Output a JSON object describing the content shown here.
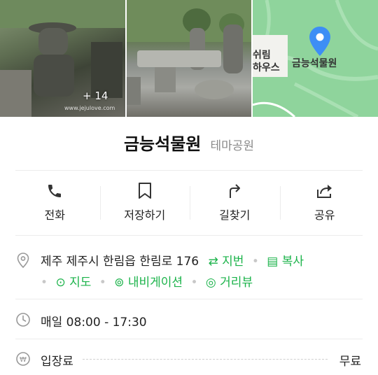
{
  "photos": {
    "more_count": "+ 14",
    "watermark": "www.jejulove.com"
  },
  "map": {
    "place_label": "금능석물원",
    "nearby_label_1": "쉬림",
    "nearby_label_2": "하우스"
  },
  "place": {
    "name": "금능석물원",
    "category": "테마공원"
  },
  "actions": [
    {
      "label": "전화",
      "icon": "phone-icon"
    },
    {
      "label": "저장하기",
      "icon": "bookmark-icon"
    },
    {
      "label": "길찾기",
      "icon": "directions-icon"
    },
    {
      "label": "공유",
      "icon": "share-icon"
    }
  ],
  "address": {
    "text": "제주 제주시 한림읍 한림로 176",
    "lot_number": "지번",
    "copy": "복사",
    "map": "지도",
    "navigation": "내비게이션",
    "street_view": "거리뷰"
  },
  "hours": {
    "text": "매일 08:00 - 17:30"
  },
  "fee": {
    "label": "입장료",
    "value": "무료"
  },
  "colors": {
    "accent_green": "#1bb34a",
    "map_pin_blue": "#3d8ef5",
    "map_green": "#8fd49c"
  }
}
